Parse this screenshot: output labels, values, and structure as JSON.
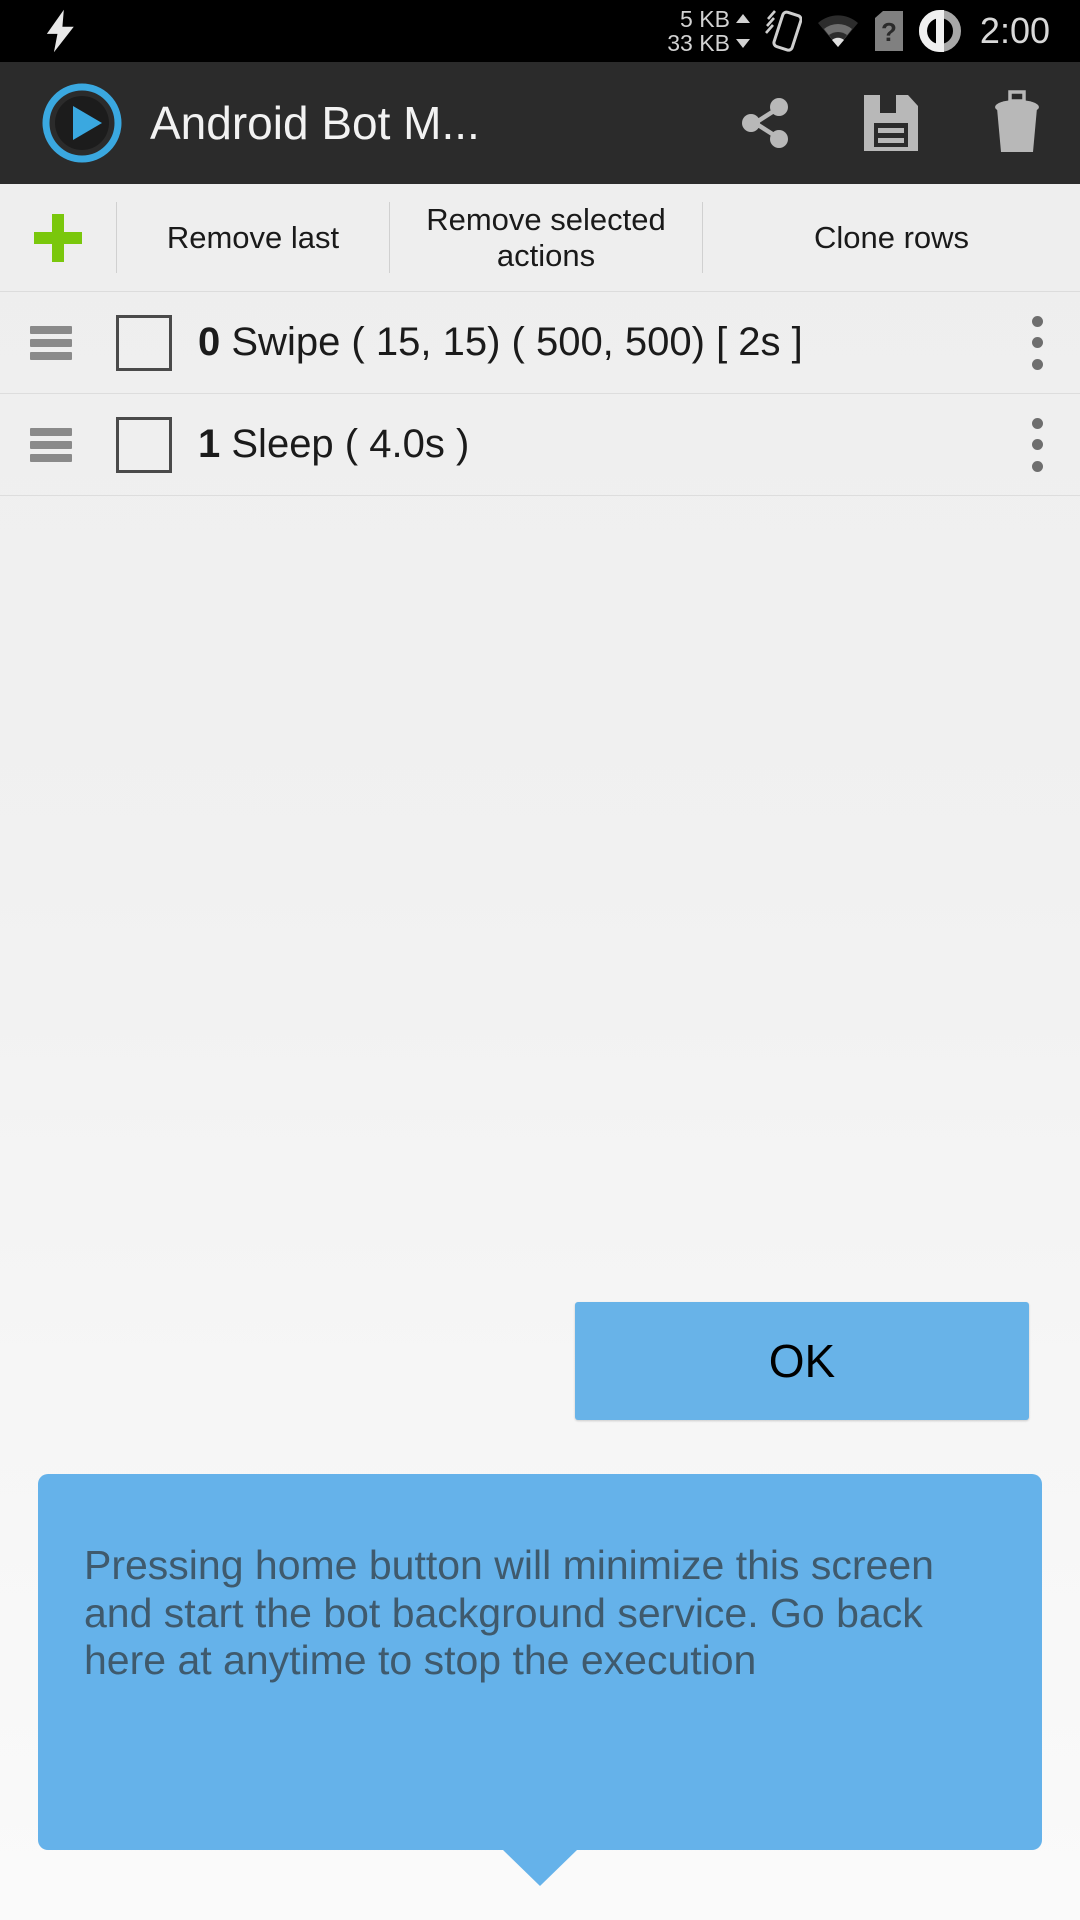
{
  "statusbar": {
    "bolt_icon": "lightning-bolt-icon",
    "upload_rate": "5 KB",
    "download_rate": "33 KB",
    "vibrate_icon": "vibrate-icon",
    "wifi_icon": "wifi-icon",
    "sim_icon": "sim-card-question-icon",
    "battery_icon": "battery-circle-icon",
    "clock": "2:00"
  },
  "appbar": {
    "logo_icon": "play-circle-logo-icon",
    "title": "Android Bot M...",
    "actions": [
      {
        "name": "share-button",
        "icon": "share-icon"
      },
      {
        "name": "save-button",
        "icon": "floppy-disk-save-icon"
      },
      {
        "name": "delete-button",
        "icon": "trash-delete-icon"
      }
    ]
  },
  "toolbar": {
    "add_icon": "plus-add-icon",
    "remove_last_label": "Remove last",
    "remove_selected_label": "Remove selected actions",
    "clone_rows_label": "Clone rows"
  },
  "action_list": {
    "rows": [
      {
        "index": "0",
        "text": "Swipe ( 15, 15)  ( 500, 500)  [ 2s ]",
        "checked": false,
        "drag_icon": "drag-handle-icon",
        "menu_icon": "overflow-menu-icon"
      },
      {
        "index": "1",
        "text": "Sleep ( 4.0s )",
        "checked": false,
        "drag_icon": "drag-handle-icon",
        "menu_icon": "overflow-menu-icon"
      }
    ]
  },
  "tooltip": {
    "ok_label": "OK",
    "message": "Pressing home button will minimize this screen and start the bot background service. Go back here at anytime to stop the execution"
  },
  "colors": {
    "accent_blue": "#65b2ea",
    "logo_blue": "#3aa8e0",
    "add_green": "#7ac70c",
    "appbar_bg": "#2b2b2b",
    "statusbar_bg": "#000000",
    "tooltip_text": "#3f5a6d"
  }
}
